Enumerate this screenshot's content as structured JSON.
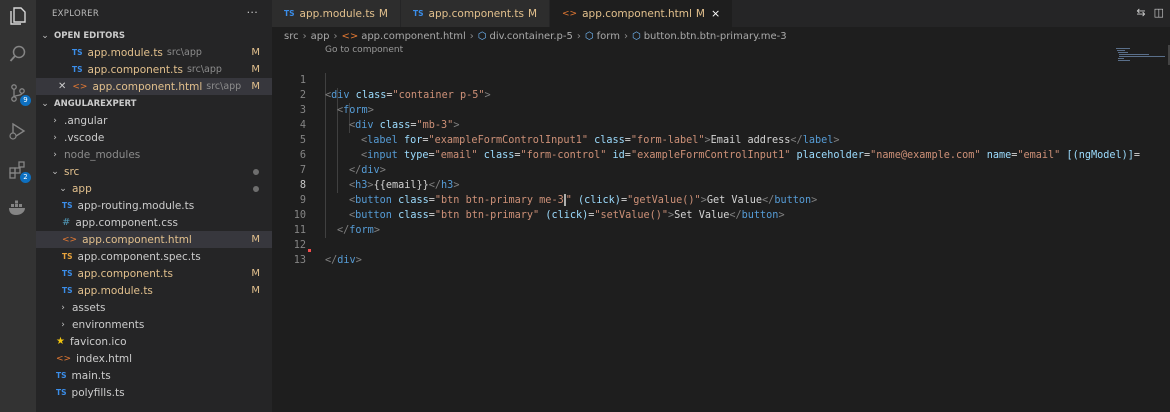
{
  "activity_bar": {
    "items": [
      {
        "icon": "files-icon"
      },
      {
        "icon": "search-icon"
      },
      {
        "icon": "source-control-icon",
        "badge": "9"
      },
      {
        "icon": "run-debug-icon"
      },
      {
        "icon": "extensions-icon",
        "badge": "2"
      },
      {
        "icon": "docker-icon"
      }
    ]
  },
  "sidebar": {
    "title": "EXPLORER",
    "more": "···",
    "open_editors": {
      "label": "OPEN EDITORS",
      "items": [
        {
          "name": "app.module.ts",
          "path": "src\\app",
          "status": "M"
        },
        {
          "name": "app.component.ts",
          "path": "src\\app",
          "status": "M"
        },
        {
          "name": "app.component.html",
          "path": "src\\app",
          "status": "M"
        }
      ]
    },
    "workspace": {
      "label": "ANGULAREXPERT",
      "items": [
        {
          "name": ".angular"
        },
        {
          "name": ".vscode"
        },
        {
          "name": "node_modules"
        },
        {
          "name": "src"
        },
        {
          "name": "app"
        },
        {
          "name": "app-routing.module.ts"
        },
        {
          "name": "app.component.css"
        },
        {
          "name": "app.component.html",
          "status": "M"
        },
        {
          "name": "app.component.spec.ts"
        },
        {
          "name": "app.component.ts",
          "status": "M"
        },
        {
          "name": "app.module.ts",
          "status": "M"
        },
        {
          "name": "assets"
        },
        {
          "name": "environments"
        },
        {
          "name": "favicon.ico"
        },
        {
          "name": "index.html"
        },
        {
          "name": "main.ts"
        },
        {
          "name": "polyfills.ts"
        }
      ]
    }
  },
  "tabs": [
    {
      "label": "app.module.ts",
      "status": "M",
      "icon": "TS"
    },
    {
      "label": "app.component.ts",
      "status": "M",
      "icon": "TS"
    },
    {
      "label": "app.component.html",
      "status": "M",
      "close": "×"
    }
  ],
  "breadcrumb": [
    "src",
    "app",
    "app.component.html",
    "div.container.p-5",
    "form",
    "button.btn.btn-primary.me-3"
  ],
  "editor": {
    "codelens": "Go to component",
    "line_numbers": [
      "1",
      "2",
      "3",
      "4",
      "5",
      "6",
      "7",
      "8",
      "9",
      "10",
      "11",
      "12",
      "13"
    ],
    "lines": {
      "l1": {
        "a": "<",
        "b": "div",
        "c": " class",
        "d": "=",
        "e": "\"container p-5\"",
        "f": ">"
      },
      "l2": {
        "a": "<",
        "b": "form",
        "f": ">"
      },
      "l3": {
        "a": "<",
        "b": "div",
        "c": " class",
        "d": "=",
        "e": "\"mb-3\"",
        "f": ">"
      },
      "l4": {
        "a": "<",
        "b": "label",
        "c1": " for",
        "e1": "\"exampleFormControlInput1\"",
        "c2": " class",
        "e2": "\"form-label\"",
        "txt": "Email address",
        "close": "label"
      },
      "l5": {
        "a": "<",
        "b": "input",
        "c1": " type",
        "e1": "\"email\"",
        "c2": " class",
        "e2": "\"form-control\"",
        "c3": " id",
        "e3": "\"exampleFormControlInput1\"",
        "c4": " placeholder",
        "e4": "\"name@example.com\"",
        "c5": " name",
        "e5": "\"email\"",
        "c6": " [(ngModel)]",
        "tail": "="
      },
      "l6": {
        "b": "div"
      },
      "l7": {
        "b": "h3",
        "txt": "{{email}}"
      },
      "l8": {
        "b": "button",
        "c1": " class",
        "e1a": "\"btn btn-primary me-3",
        "e1b": "\"",
        "c2": " (click)",
        "e2": "\"getValue()\"",
        "txt": "Get Value"
      },
      "l9": {
        "b": "button",
        "c1": " class",
        "e1": "\"btn btn-primary\"",
        "c2": " (click)",
        "e2": "\"setValue()\"",
        "txt": "Set Value"
      },
      "l10": {
        "b": "form"
      },
      "l12": {
        "b": "div"
      }
    },
    "current_line": 8
  }
}
